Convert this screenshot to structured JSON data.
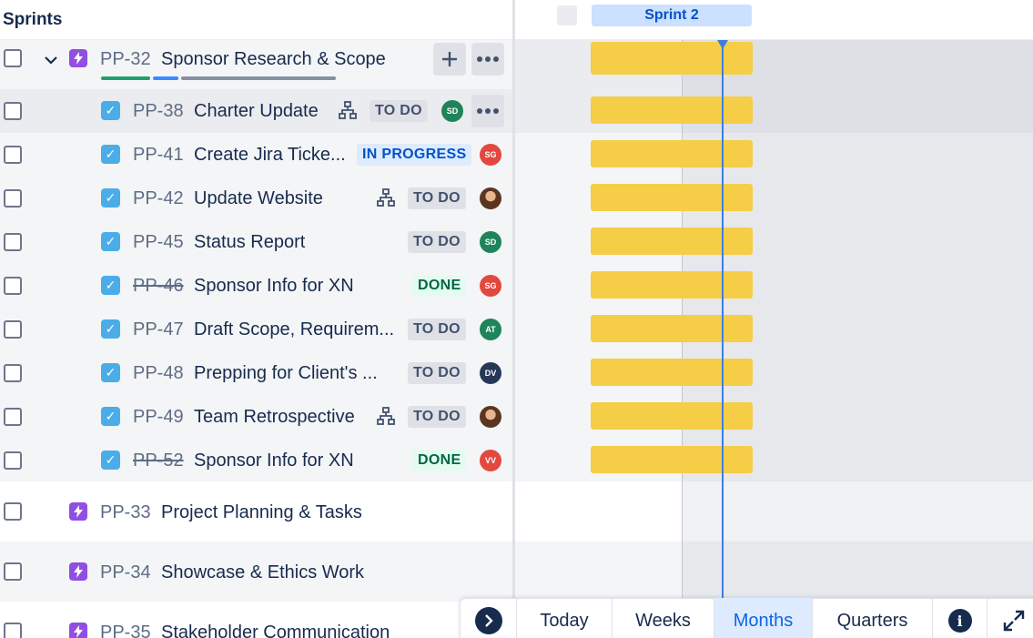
{
  "sprints_header": "Sprints",
  "sprint_name": "Sprint 2",
  "epic_main": {
    "key": "PP-32",
    "title": "Sponsor Research & Scope",
    "add_label": "+",
    "more_label": "•••",
    "progress_colors": [
      "#22a06b",
      "#388bff",
      "#8590a2"
    ]
  },
  "children": [
    {
      "key": "PP-38",
      "title": "Charter Update",
      "status": "TO DO",
      "assignee": "SD",
      "avatar_color": "#1f845a",
      "hier": true
    },
    {
      "key": "PP-41",
      "title": "Create Jira Ticke...",
      "status": "IN PROGRESS",
      "assignee": "SG",
      "avatar_color": "#e2483d",
      "hier": false
    },
    {
      "key": "PP-42",
      "title": "Update Website",
      "status": "TO DO",
      "assignee": "",
      "avatar_color": "photo",
      "hier": true
    },
    {
      "key": "PP-45",
      "title": "Status Report",
      "status": "TO DO",
      "assignee": "SD",
      "avatar_color": "#1f845a",
      "hier": false
    },
    {
      "key": "PP-46",
      "title": "Sponsor Info for XN",
      "status": "DONE",
      "assignee": "SG",
      "avatar_color": "#e2483d",
      "hier": false
    },
    {
      "key": "PP-47",
      "title": "Draft Scope, Requirem...",
      "status": "TO DO",
      "assignee": "AT",
      "avatar_color": "#1f845a",
      "hier": false
    },
    {
      "key": "PP-48",
      "title": "Prepping for Client's ...",
      "status": "TO DO",
      "assignee": "DV",
      "avatar_color": "#253858",
      "hier": false
    },
    {
      "key": "PP-49",
      "title": "Team Retrospective",
      "status": "TO DO",
      "assignee": "",
      "avatar_color": "photo",
      "hier": true
    },
    {
      "key": "PP-52",
      "title": "Sponsor Info for XN",
      "status": "DONE",
      "assignee": "VV",
      "avatar_color": "#e2483d",
      "hier": false
    }
  ],
  "child_more_label": "•••",
  "other_epics": [
    {
      "key": "PP-33",
      "title": "Project Planning & Tasks"
    },
    {
      "key": "PP-34",
      "title": "Showcase & Ethics Work"
    },
    {
      "key": "PP-35",
      "title": "Stakeholder Communication"
    }
  ],
  "toolbar": {
    "today": "Today",
    "weeks": "Weeks",
    "months": "Months",
    "quarters": "Quarters",
    "active": "Months",
    "info_label": "i"
  },
  "colors": {
    "bar": "#f5cd47",
    "today_line": "#3d7ee0",
    "epic_icon": "#904ee2",
    "task_icon": "#4bade8"
  }
}
